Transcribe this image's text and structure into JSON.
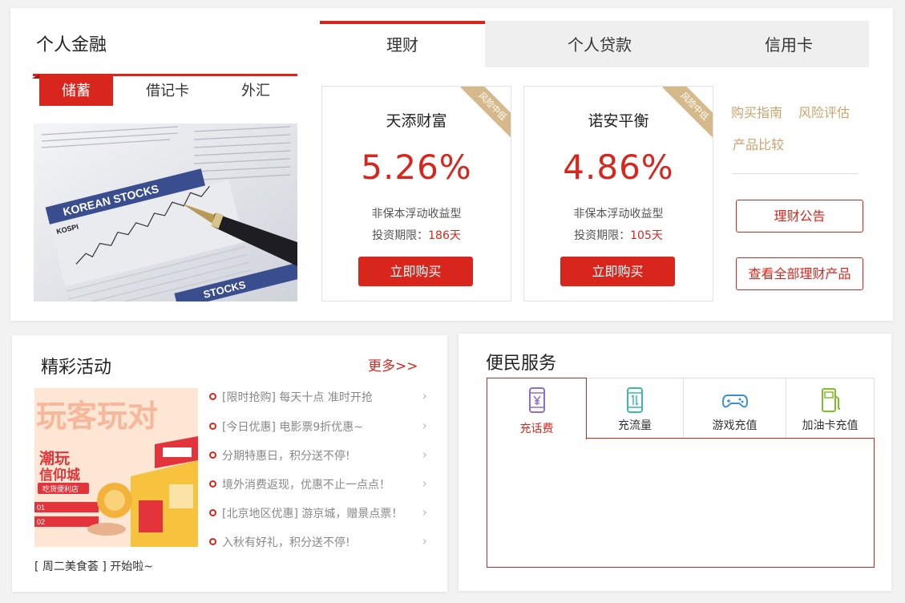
{
  "finance": {
    "title": "个人金融",
    "tabs": [
      "储蓄",
      "借记卡",
      "外汇"
    ],
    "active_tab": "储蓄"
  },
  "main_tabs": [
    "理财",
    "个人贷款",
    "信用卡"
  ],
  "active_main_tab": "理财",
  "image_text": {
    "korean_stocks": "KOREAN STOCKS",
    "kospi": "KOSPI",
    "stocks": "STOCKS"
  },
  "products": [
    {
      "ribbon": "风险中低",
      "name": "天添财富",
      "rate": "5.26%",
      "type": "非保本浮动收益型",
      "term_label": "投资期限：",
      "term_days": "186天",
      "buy": "立即购买"
    },
    {
      "ribbon": "风险中低",
      "name": "诺安平衡",
      "rate": "4.86%",
      "type": "非保本浮动收益型",
      "term_label": "投资期限：",
      "term_days": "105天",
      "buy": "立即购买"
    }
  ],
  "side": {
    "links": [
      "购买指南",
      "风险评估",
      "产品比较"
    ],
    "announcement": "理财公告",
    "all_products": "查看全部理财产品"
  },
  "activities": {
    "title": "精彩活动",
    "more": "更多>>",
    "image_text": {
      "main": "玩客玩对",
      "sub1": "潮玩",
      "sub2": "信仰城",
      "tag": "吃货便利店",
      "n1": "01",
      "n2": "02"
    },
    "items": [
      "[限时抢购] 每天十点 准时开抢",
      "[今日优惠] 电影票9折优惠~",
      "分期特惠日，积分送不停!",
      "境外消费返现，优惠不止一点点！",
      "[北京地区优惠] 游京城，赠景点票！",
      "入秋有好礼，积分送不停!"
    ],
    "caption": "[ 周二美食荟 ] 开始啦~"
  },
  "services": {
    "title": "便民服务",
    "tabs": [
      {
        "label": "充话费",
        "icon": "phone-yuan-icon"
      },
      {
        "label": "充流量",
        "icon": "phone-data-icon"
      },
      {
        "label": "游戏充值",
        "icon": "gamepad-icon"
      },
      {
        "label": "加油卡充值",
        "icon": "fuel-pump-icon"
      }
    ],
    "active_tab": "充话费"
  },
  "colors": {
    "accent": "#d9261c",
    "gold": "#c8a46c"
  }
}
